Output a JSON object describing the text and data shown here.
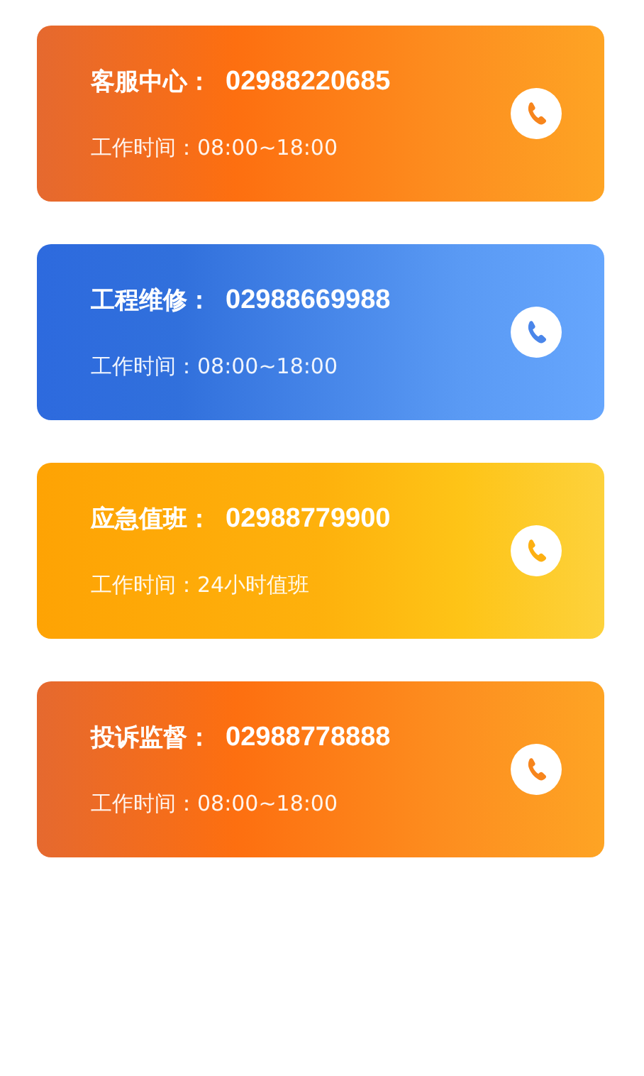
{
  "contacts": [
    {
      "kind": "orange",
      "label": "客服中心：",
      "phone": "02988220685",
      "hours_label": "工作时间：",
      "hours": "08:00~18:00"
    },
    {
      "kind": "blue",
      "label": "工程维修：",
      "phone": "02988669988",
      "hours_label": "工作时间：",
      "hours": "08:00~18:00"
    },
    {
      "kind": "yellow",
      "label": "应急值班：",
      "phone": "02988779900",
      "hours_label": "工作时间：",
      "hours": "24小时值班"
    },
    {
      "kind": "orange",
      "label": "投诉监督：",
      "phone": "02988778888",
      "hours_label": "工作时间：",
      "hours": "08:00~18:00"
    }
  ]
}
